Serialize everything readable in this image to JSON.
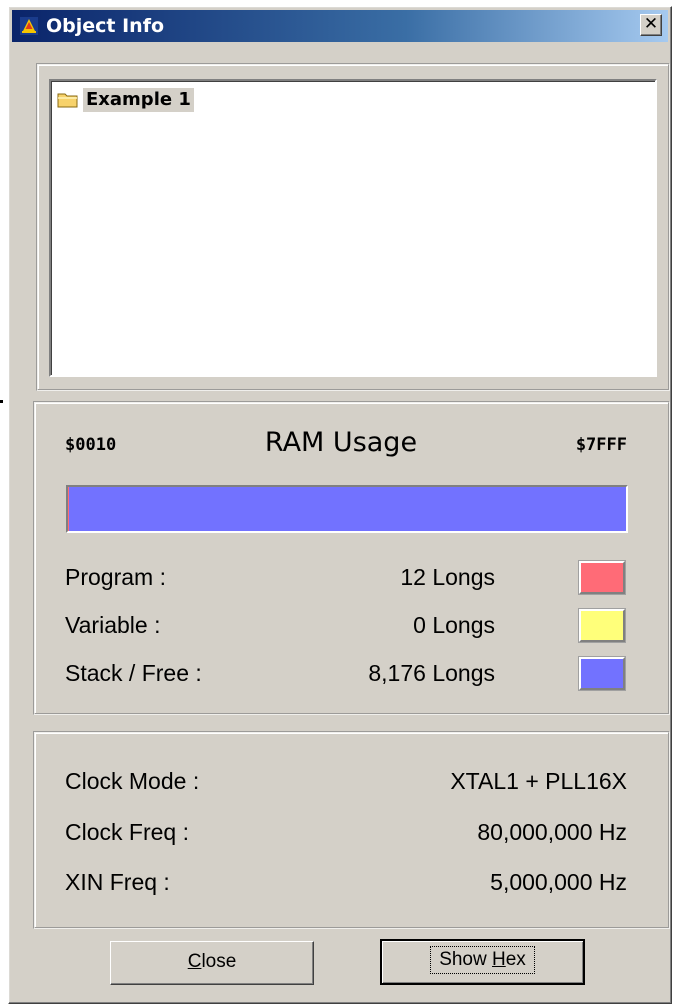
{
  "window": {
    "title": "Object Info",
    "close_glyph": "✕"
  },
  "tree": {
    "items": [
      {
        "label": "Example 1",
        "icon": "folder-icon"
      }
    ]
  },
  "ram": {
    "title": "RAM Usage",
    "start_address": "$0010",
    "end_address": "$7FFF",
    "bar": {
      "program_fraction": 0.0015,
      "variable_fraction": 0.0,
      "stack_free_fraction": 0.9985
    },
    "rows": [
      {
        "label": "Program :",
        "value": "12 Longs",
        "color": "#ff6b77"
      },
      {
        "label": "Variable :",
        "value": "0 Longs",
        "color": "#ffff7a"
      },
      {
        "label": "Stack / Free :",
        "value": "8,176 Longs",
        "color": "#7272ff"
      }
    ]
  },
  "clock": {
    "rows": [
      {
        "label": "Clock Mode :",
        "value": "XTAL1 + PLL16X"
      },
      {
        "label": "Clock Freq :",
        "value": "80,000,000 Hz"
      },
      {
        "label": "XIN Freq :",
        "value": "5,000,000 Hz"
      }
    ]
  },
  "buttons": {
    "close": {
      "label_underlined": "C",
      "label_rest": "lose"
    },
    "show_hex": {
      "label_prefix": "Show ",
      "label_underlined": "H",
      "label_rest": "ex"
    }
  },
  "colors": {
    "titlebar_start": "#0a246a",
    "titlebar_end": "#a6caf0",
    "dialog_face": "#d4d0c8",
    "stack_free": "#7272ff",
    "program": "#ff6b77",
    "variable": "#ffff7a"
  }
}
